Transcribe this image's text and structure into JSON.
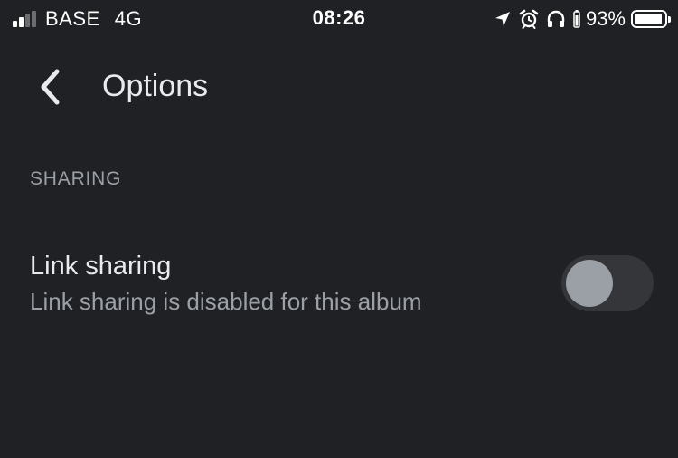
{
  "status_bar": {
    "carrier": "BASE",
    "network": "4G",
    "time": "08:26",
    "battery_percent": "93%",
    "battery_level": 0.93,
    "signal_bars_active": 2,
    "signal_bars_total": 4,
    "icons": [
      "location-arrow-icon",
      "alarm-clock-icon",
      "headphones-icon"
    ]
  },
  "app_bar": {
    "back_icon": "chevron-left-icon",
    "title": "Options"
  },
  "sections": [
    {
      "header": "SHARING",
      "settings": [
        {
          "title": "Link sharing",
          "description": "Link sharing is disabled for this album",
          "toggle_on": false
        }
      ]
    }
  ],
  "colors": {
    "background": "#202124",
    "primary_text": "#e8eaed",
    "secondary_text": "#9aa0a6",
    "toggle_track_off": "#35363a",
    "toggle_knob_off": "#9aa0a6"
  }
}
